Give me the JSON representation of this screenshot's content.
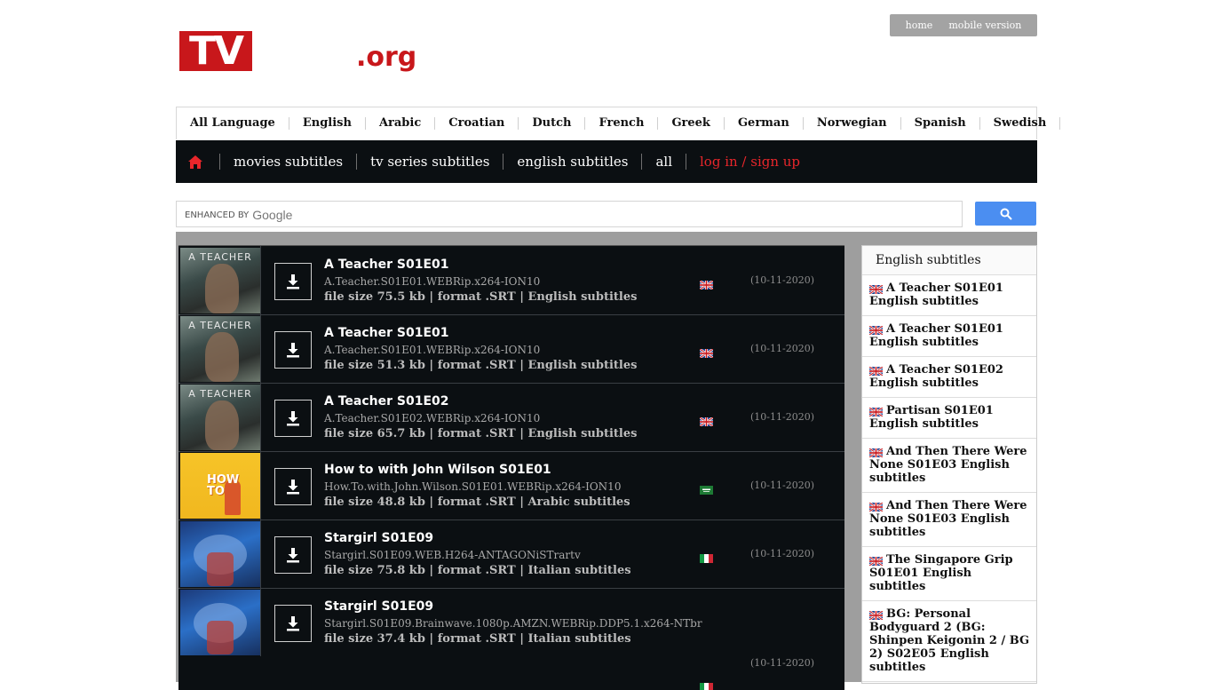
{
  "header": {
    "logo_tv": "TV",
    "logo_org": ".org",
    "top_links": [
      "home",
      "mobile version"
    ]
  },
  "languages": [
    "All Language",
    "English",
    "Arabic",
    "Croatian",
    "Dutch",
    "French",
    "Greek",
    "German",
    "Norwegian",
    "Spanish",
    "Swedish"
  ],
  "nav": {
    "home_icon": "home-icon",
    "items": [
      "movies subtitles",
      "tv series subtitles",
      "english subtitles",
      "all"
    ],
    "login": "log in / sign up"
  },
  "search": {
    "enhanced_by": "ENHANCED BY",
    "google": "Google",
    "button_icon": "search-icon",
    "button_color": "#4b8ef1"
  },
  "subtitles": [
    {
      "title": "A Teacher S01E01",
      "release": "A.Teacher.S01E01.WEBRip.x264-ION10",
      "meta": "file size 75.5 kb | format .SRT | English subtitles",
      "flag": "uk",
      "date": "(10-11-2020)",
      "thumb_text": "A TEACHER"
    },
    {
      "title": "A Teacher S01E01",
      "release": "A.Teacher.S01E01.WEBRip.x264-ION10",
      "meta": "file size 51.3 kb | format .SRT | English subtitles",
      "flag": "uk",
      "date": "(10-11-2020)",
      "thumb_text": "A TEACHER"
    },
    {
      "title": "A Teacher S01E02",
      "release": "A.Teacher.S01E02.WEBRip.x264-ION10",
      "meta": "file size 65.7 kb | format .SRT | English subtitles",
      "flag": "uk",
      "date": "(10-11-2020)",
      "thumb_text": "A TEACHER"
    },
    {
      "title": "How to with John Wilson S01E01",
      "release": "How.To.with.John.Wilson.S01E01.WEBRip.x264-ION10",
      "meta": "file size 48.8 kb | format .SRT | Arabic subtitles",
      "flag": "sa",
      "date": "(10-11-2020)",
      "thumb_text": "HOW TO"
    },
    {
      "title": "Stargirl S01E09",
      "release": "Stargirl.S01E09.WEB.H264-ANTAGONiSTrartv",
      "meta": "file size 75.8 kb | format .SRT | Italian subtitles",
      "flag": "it",
      "date": "(10-11-2020)",
      "thumb_text": ""
    },
    {
      "title": "Stargirl S01E09",
      "release": "Stargirl.S01E09.Brainwave.1080p.AMZN.WEBRip.DDP5.1.x264-NTbr",
      "meta": "file size 37.4 kb | format .SRT | Italian subtitles",
      "flag": "it",
      "date": "(10-11-2020)",
      "thumb_text": ""
    }
  ],
  "sidebar": {
    "heading": "English subtitles",
    "items": [
      "A Teacher S01E01 English subtitles",
      "A Teacher S01E01 English subtitles",
      "A Teacher S01E02 English subtitles",
      "Partisan S01E01 English subtitles",
      "And Then There Were None S01E03 English subtitles",
      "And Then There Were None S01E03 English subtitles",
      "The Singapore Grip S01E01 English subtitles",
      "BG: Personal Bodyguard 2 (BG: Shinpen Keigonin 2 / BG 2) S02E05 English subtitles"
    ]
  },
  "colors": {
    "brand_red": "#c8171b",
    "nav_bg": "#0b0f12",
    "login_red": "#e8262b"
  }
}
